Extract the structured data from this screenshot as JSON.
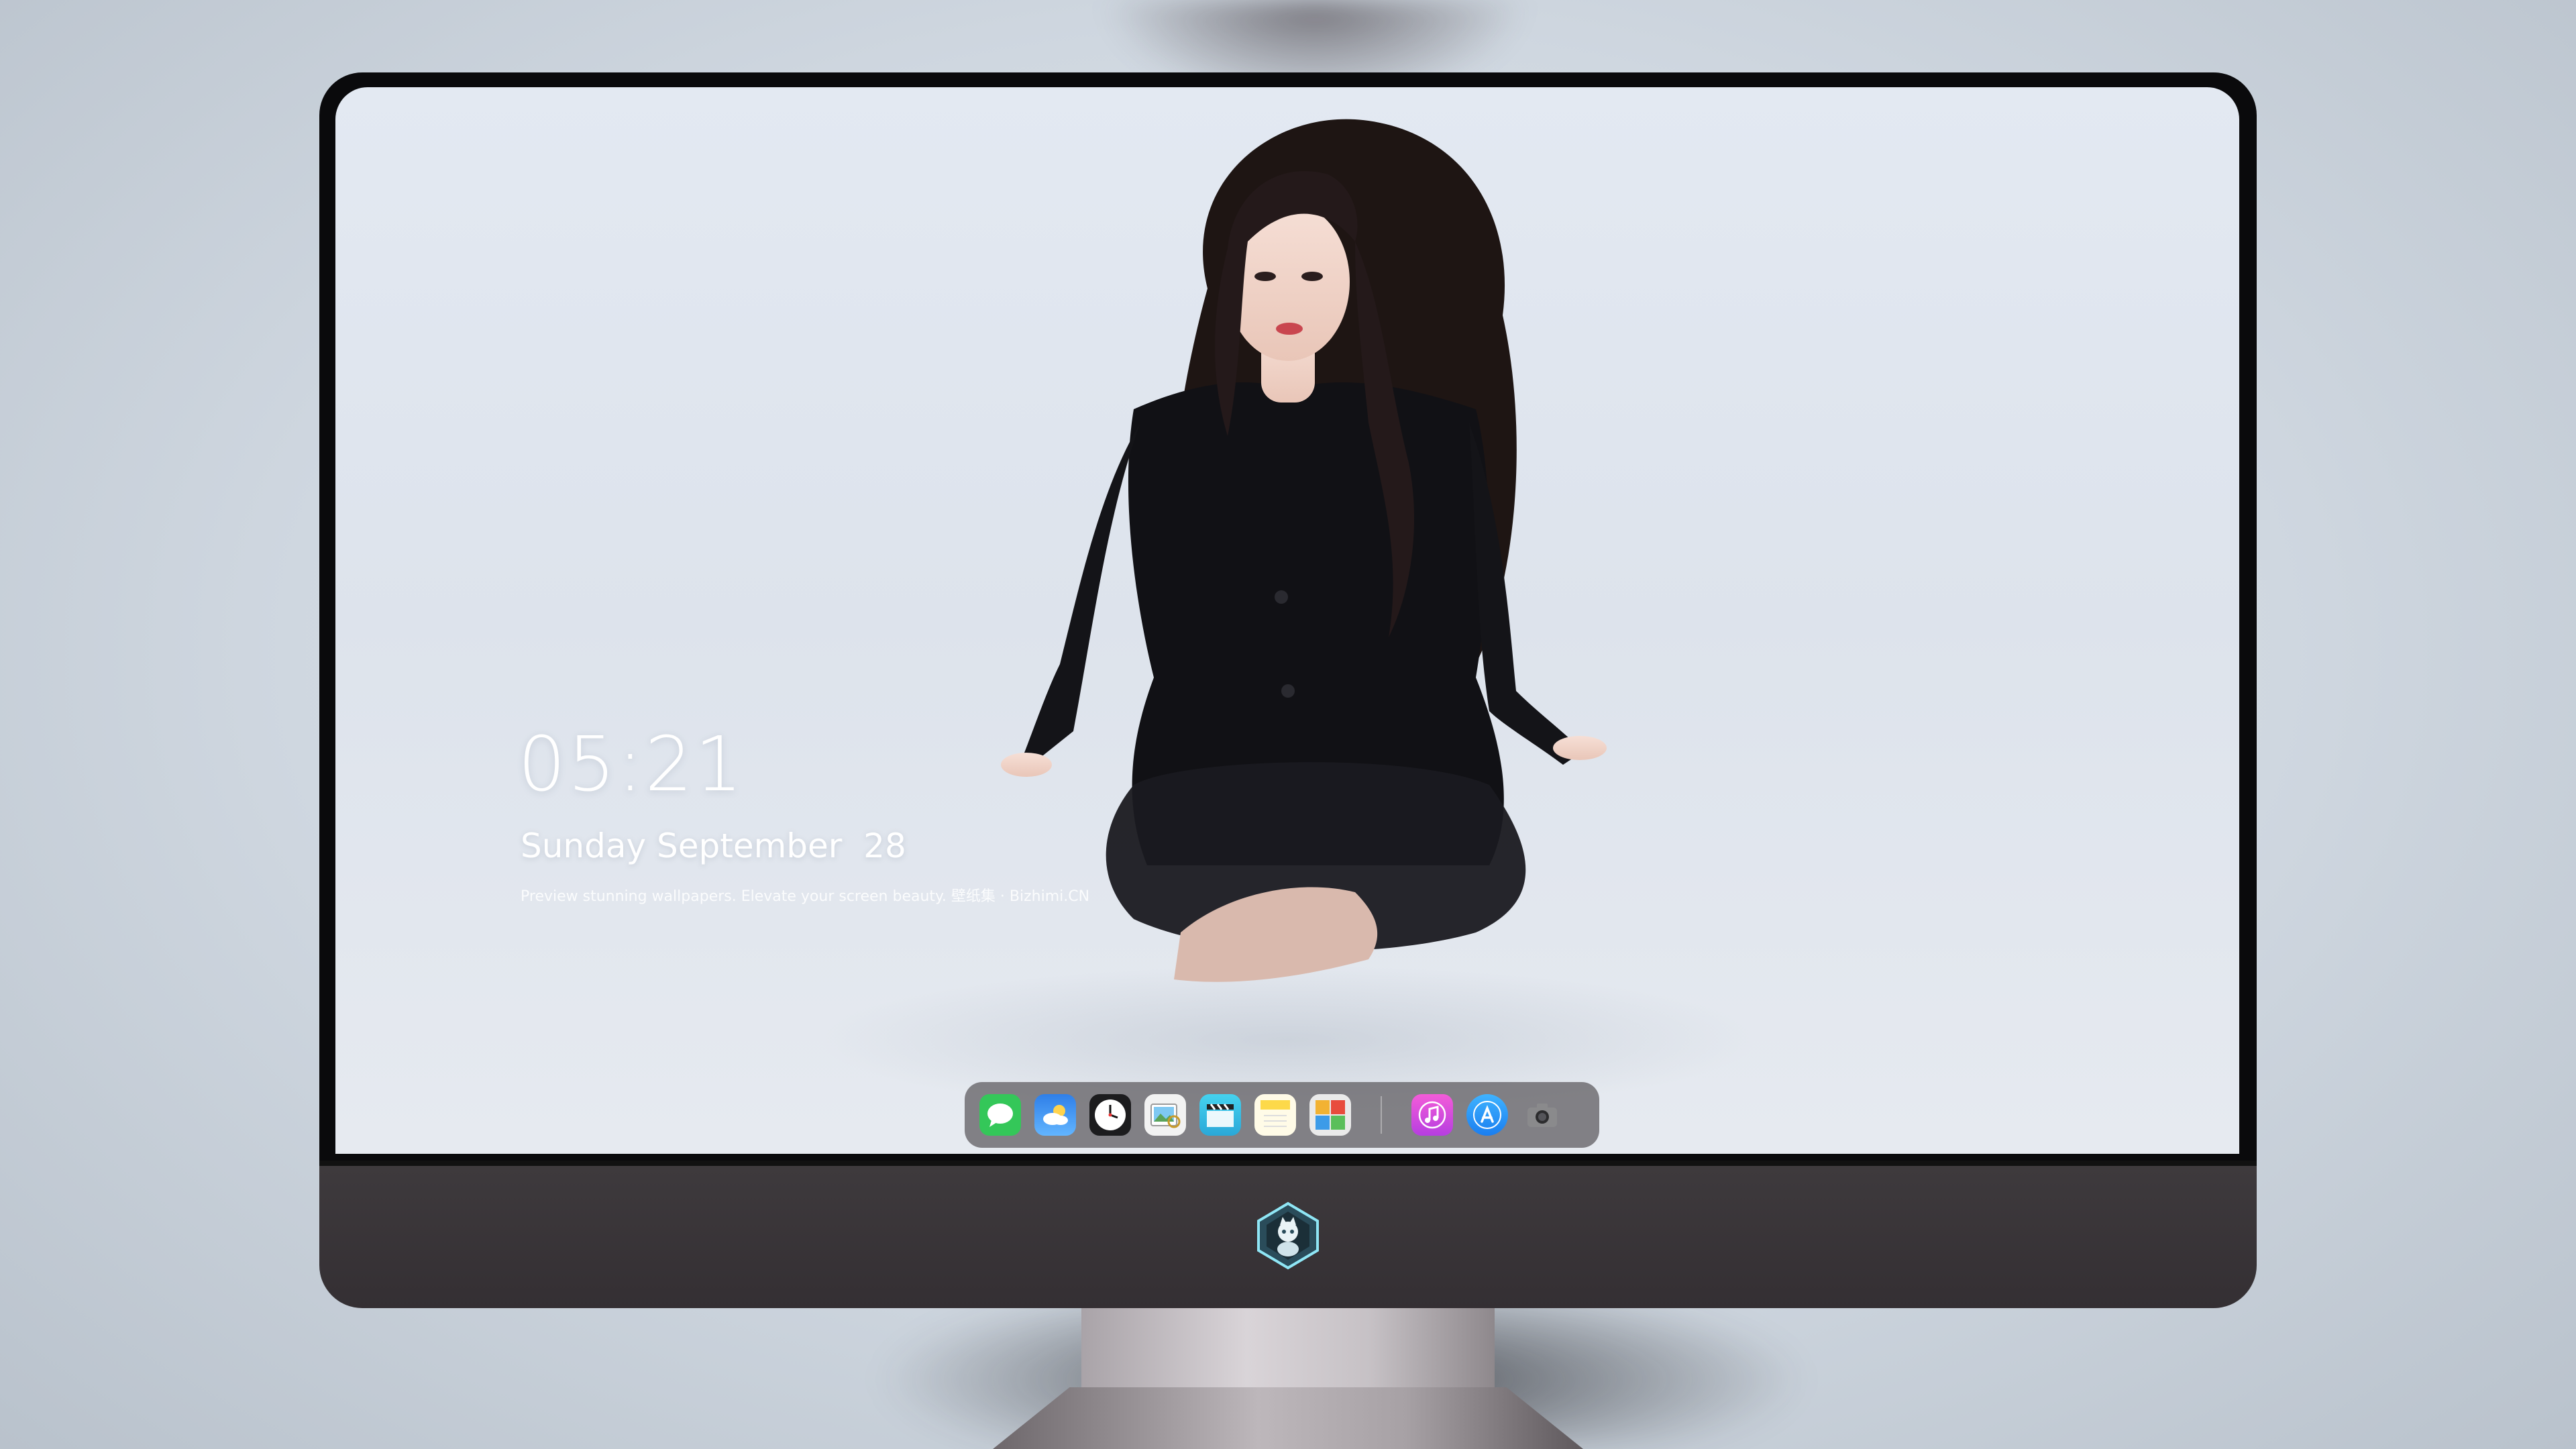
{
  "clock": {
    "time": "05:21",
    "date": "Sunday September  28",
    "tagline": "Preview stunning wallpapers. Elevate your screen beauty. 壁纸集 · Bizhimi.CN"
  },
  "dock": {
    "apps": [
      {
        "name": "messages-icon",
        "color": "#34c759"
      },
      {
        "name": "weather-icon",
        "color": "#2f8cf0"
      },
      {
        "name": "clock-icon",
        "color": "#1c1c1e"
      },
      {
        "name": "preview-icon",
        "color": "#f2f2f2"
      },
      {
        "name": "claquette-icon",
        "color": "#3ec7e6"
      },
      {
        "name": "notes-icon",
        "color": "#fedc4f"
      },
      {
        "name": "photo-booth-icon",
        "color": "#e8e8e8"
      },
      {
        "name": "itunes-icon",
        "color": "#e44bd6"
      },
      {
        "name": "app-store-icon",
        "color": "#1a8cf5"
      },
      {
        "name": "camera-icon",
        "color": "#6b6b6d"
      }
    ]
  },
  "colors": {
    "bezel": "#0a0a0c",
    "chin": "#3a3538",
    "dock": "#5a585c"
  }
}
